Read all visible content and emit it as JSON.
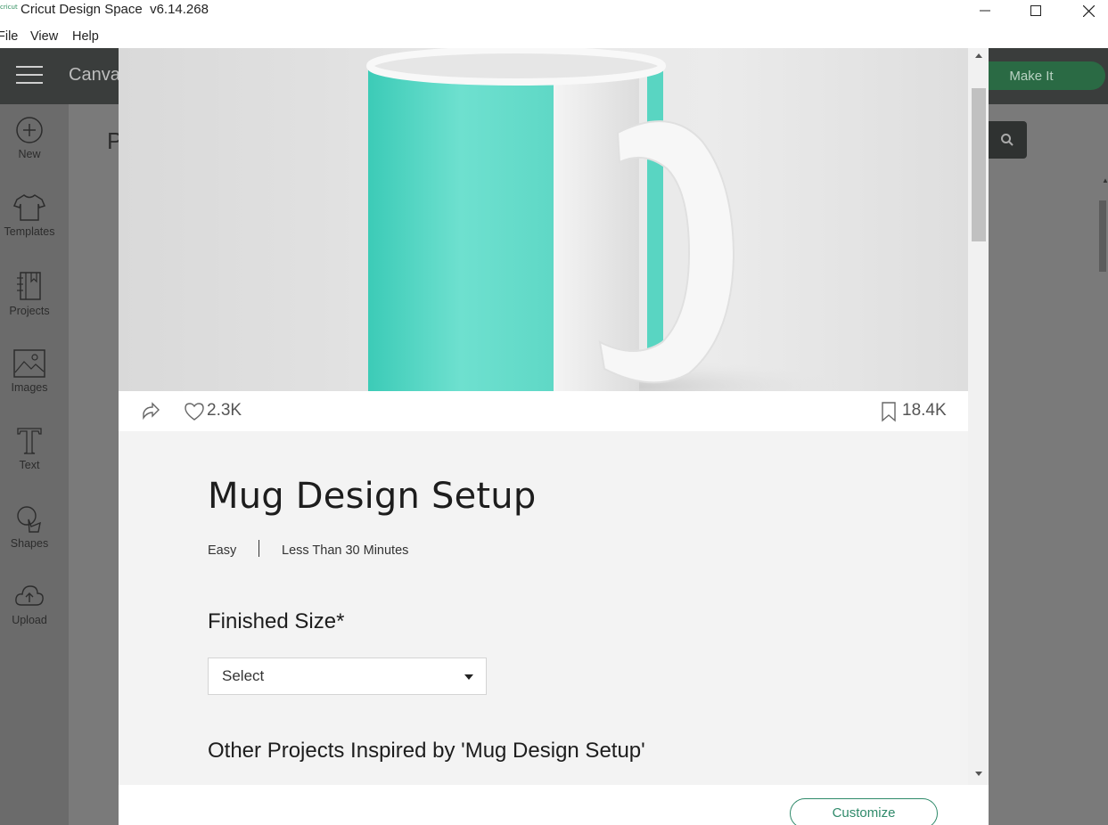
{
  "window": {
    "logo_text": "cricut",
    "title": "Cricut Design Space  v6.14.268",
    "controls": [
      "minimize",
      "maximize",
      "close"
    ]
  },
  "menubar": {
    "items": [
      {
        "label": "File"
      },
      {
        "label": "View"
      },
      {
        "label": "Help"
      }
    ]
  },
  "header": {
    "tab_label": "Canva",
    "make_it_label": "Make It"
  },
  "sidebar": {
    "items": [
      {
        "label": "New",
        "icon": "plus-circle-icon"
      },
      {
        "label": "Templates",
        "icon": "tshirt-icon"
      },
      {
        "label": "Projects",
        "icon": "notebook-icon"
      },
      {
        "label": "Images",
        "icon": "image-icon"
      },
      {
        "label": "Text",
        "icon": "text-t-icon"
      },
      {
        "label": "Shapes",
        "icon": "shapes-icon"
      },
      {
        "label": "Upload",
        "icon": "cloud-upload-icon"
      }
    ]
  },
  "background": {
    "page_letter": "P"
  },
  "modal": {
    "hero_image": "teal and white coffee mug",
    "likes": "2.3K",
    "saves": "18.4K",
    "title": "Mug Design Setup",
    "difficulty": "Easy",
    "duration": "Less Than 30 Minutes",
    "finished_size_label": "Finished Size*",
    "finished_size_select": "Select",
    "related_heading": "Other Projects Inspired by 'Mug Design Setup'",
    "customize_label": "Customize"
  },
  "colors": {
    "accent_green": "#2f8a6a",
    "make_it_green": "#2a6a44",
    "header_dark": "#3a3d3c",
    "mug_teal": "#5fd6c4"
  }
}
